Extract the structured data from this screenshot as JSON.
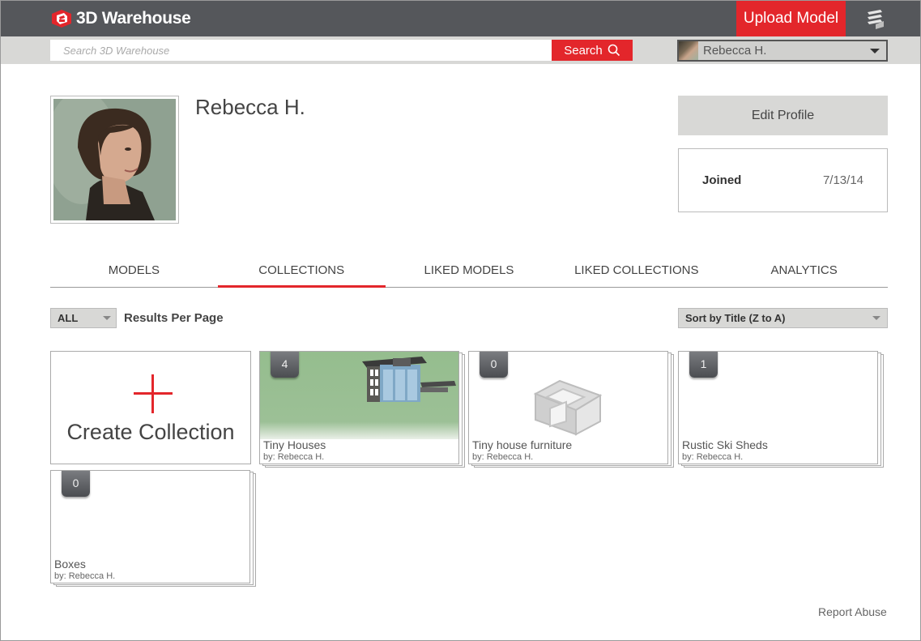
{
  "header": {
    "brand": "3D Warehouse",
    "upload_label": "Upload Model",
    "brand_color": "#e3262b"
  },
  "search": {
    "placeholder": "Search 3D Warehouse",
    "button_label": "Search"
  },
  "account": {
    "username": "Rebecca H."
  },
  "profile": {
    "name": "Rebecca H.",
    "edit_label": "Edit Profile",
    "joined_label": "Joined",
    "joined_date": "7/13/14"
  },
  "tabs": [
    {
      "label": "MODELS",
      "active": false
    },
    {
      "label": "COLLECTIONS",
      "active": true
    },
    {
      "label": "LIKED MODELS",
      "active": false
    },
    {
      "label": "LIKED COLLECTIONS",
      "active": false
    },
    {
      "label": "ANALYTICS",
      "active": false
    }
  ],
  "filters": {
    "per_page_value": "ALL",
    "per_page_label": "Results Per Page",
    "sort_value": "Sort by Title (Z to A)"
  },
  "create_collection_label": "Create Collection",
  "collections": [
    {
      "title": "Tiny Houses",
      "by": "by: Rebecca H.",
      "count": "4",
      "thumb": "house"
    },
    {
      "title": "Tiny house furniture",
      "by": "by: Rebecca H.",
      "count": "0",
      "thumb": "placeholder"
    },
    {
      "title": "Rustic Ski Sheds",
      "by": "by: Rebecca H.",
      "count": "1",
      "thumb": "empty"
    },
    {
      "title": "Boxes",
      "by": "by: Rebecca H.",
      "count": "0",
      "thumb": "empty"
    }
  ],
  "footer": {
    "report_label": "Report Abuse"
  }
}
